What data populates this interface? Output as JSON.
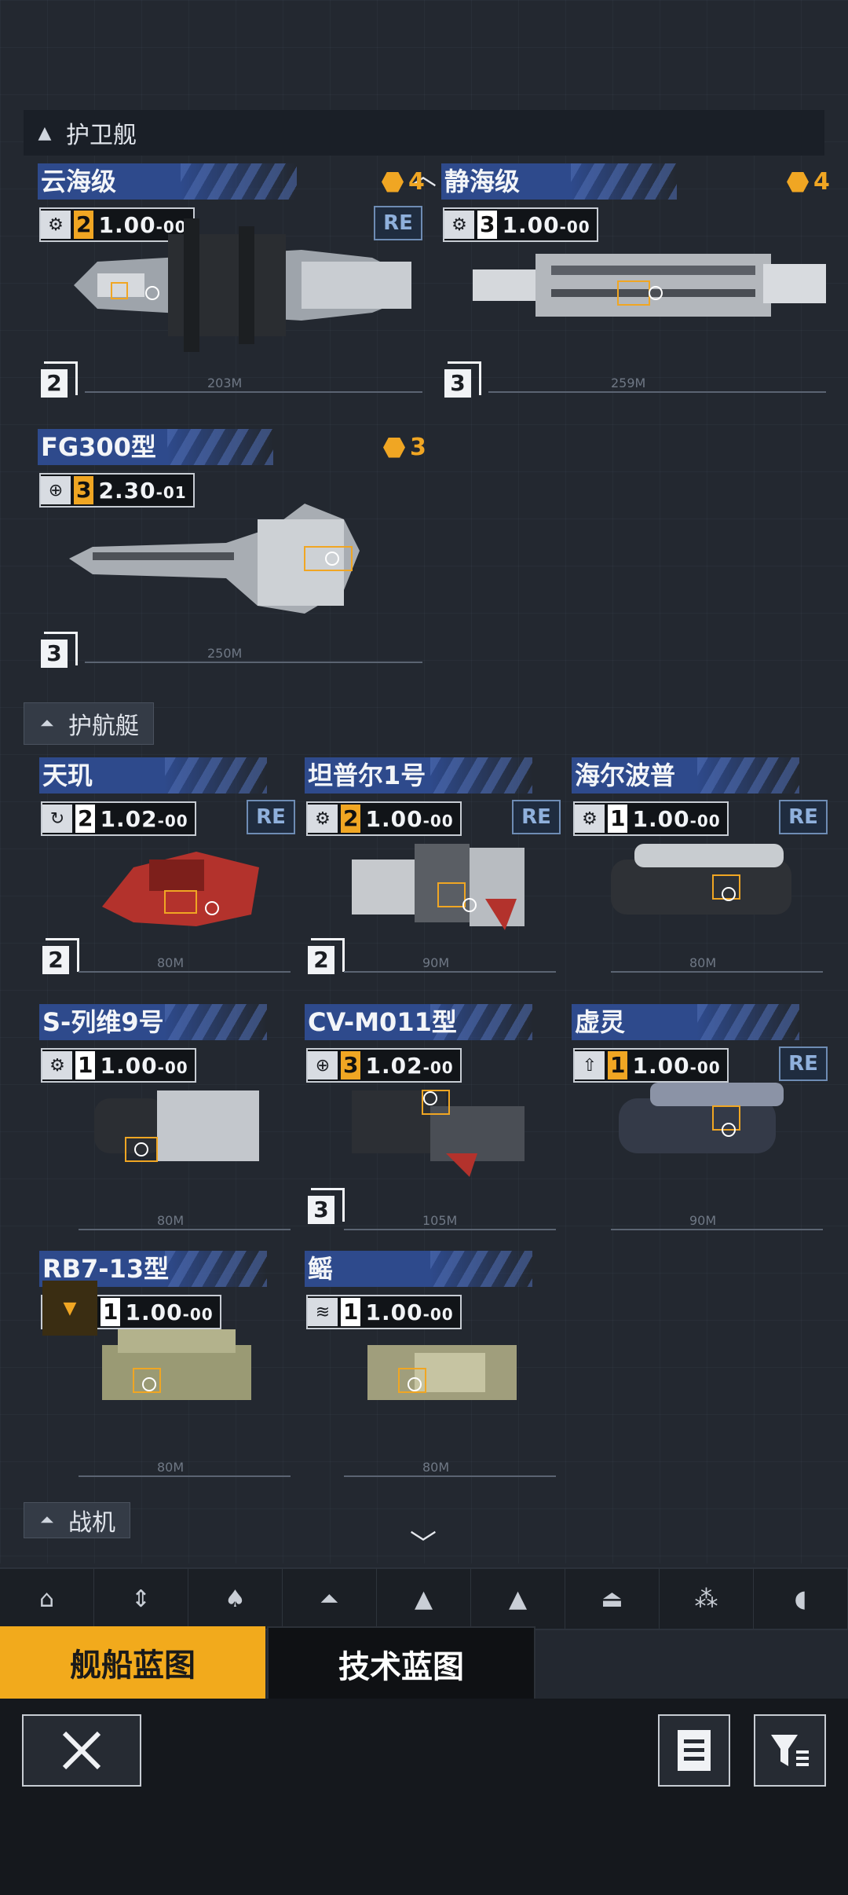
{
  "sections": {
    "frigate": "护卫舰",
    "corvette": "护航艇",
    "fighter": "战机"
  },
  "frigates": [
    {
      "name": "云海级",
      "stars": "4",
      "level": "2",
      "value": "1.00",
      "suffix": "-00",
      "count": "2",
      "re": "RE",
      "ruler": "203M"
    },
    {
      "name": "静海级",
      "stars": "4",
      "level": "3",
      "value": "1.00",
      "suffix": "-00",
      "count": "3",
      "ruler": "259M"
    },
    {
      "name": "FG300型",
      "stars": "3",
      "level": "3",
      "value": "2.30",
      "suffix": "-01",
      "count": "3",
      "ruler": "250M"
    }
  ],
  "corvettes": [
    {
      "name": "天玑",
      "level": "2",
      "value": "1.02",
      "suffix": "-00",
      "count": "2",
      "re": "RE",
      "ruler": "80M"
    },
    {
      "name": "坦普尔1号",
      "level": "2",
      "value": "1.00",
      "suffix": "-00",
      "count": "2",
      "re": "RE",
      "ruler": "90M"
    },
    {
      "name": "海尔波普",
      "level": "1",
      "value": "1.00",
      "suffix": "-00",
      "re": "RE",
      "ruler": "80M"
    },
    {
      "name": "S-列维9号",
      "level": "1",
      "value": "1.00",
      "suffix": "-00",
      "ruler": "80M"
    },
    {
      "name": "CV-M011型",
      "level": "3",
      "value": "1.02",
      "suffix": "-00",
      "count": "3",
      "ruler": "105M"
    },
    {
      "name": "虚灵",
      "level": "1",
      "value": "1.00",
      "suffix": "-00",
      "re": "RE",
      "ruler": "90M"
    },
    {
      "name": "RB7-13型",
      "level": "1",
      "value": "1.00",
      "suffix": "-00",
      "ruler": "80M"
    },
    {
      "name": "鳐",
      "level": "1",
      "value": "1.00",
      "suffix": "-00",
      "ruler": "80M"
    }
  ],
  "bottom_tabs": {
    "ship_blueprint": "舰船蓝图",
    "tech_blueprint": "技术蓝图"
  },
  "colors": {
    "accent": "#f2aa1c",
    "name_band": "#2e4a8c",
    "background": "#232830"
  },
  "icons": [
    "close-icon",
    "document-list-icon",
    "filter-icon",
    "chevron-up-icon",
    "chevron-down-icon"
  ]
}
